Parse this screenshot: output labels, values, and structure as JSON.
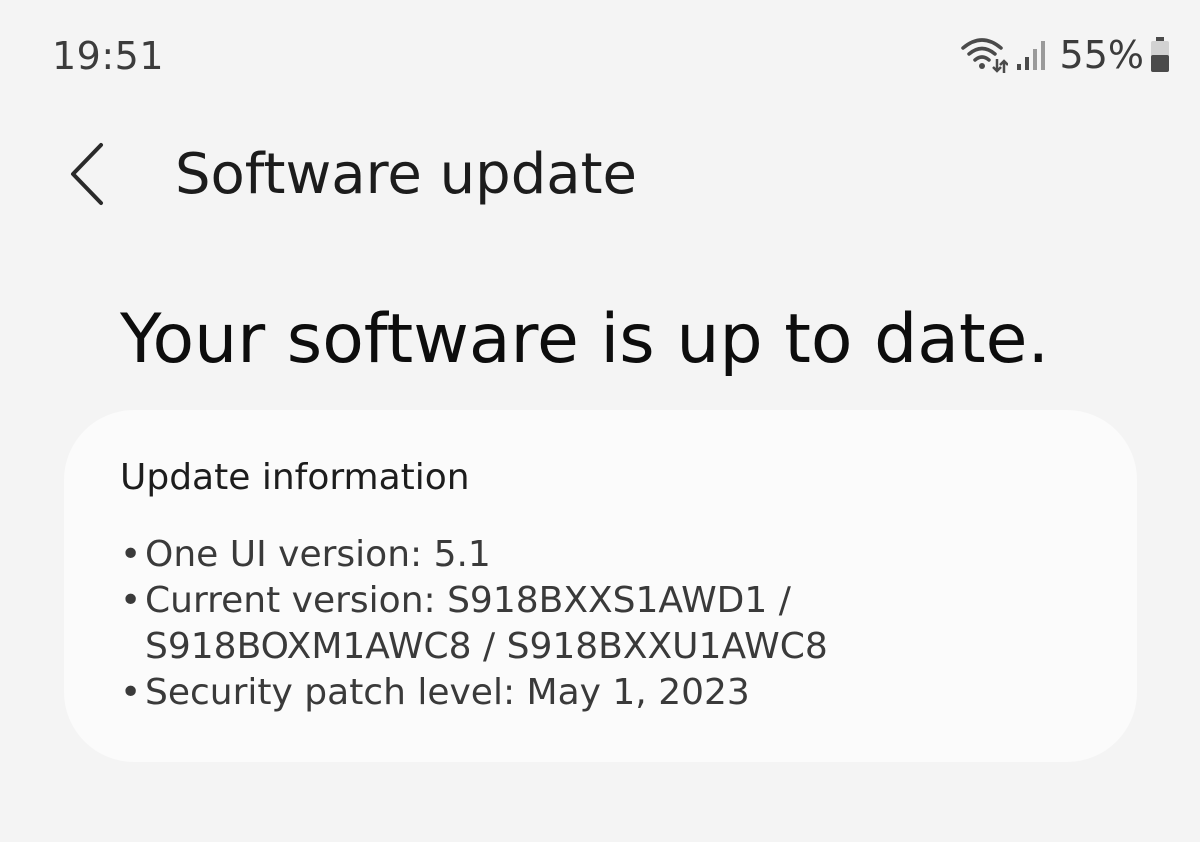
{
  "status_bar": {
    "time": "19:51",
    "battery_percent": "55%",
    "battery_level": 0.55,
    "icons": [
      "wifi-icon",
      "signal-icon",
      "battery-icon"
    ]
  },
  "header": {
    "back_icon": "chevron-left-icon",
    "title": "Software update"
  },
  "status_message": "Your software is up to date.",
  "update_info": {
    "title": "Update information",
    "bullet": "•",
    "items": [
      {
        "lines": [
          "One UI version: 5.1"
        ]
      },
      {
        "lines": [
          "Current version: S918BXXS1AWD1 /",
          "S918BOXM1AWC8 / S918BXXU1AWC8"
        ]
      },
      {
        "lines": [
          "Security patch level: May 1, 2023"
        ]
      }
    ]
  },
  "colors": {
    "background": "#f4f4f4",
    "card": "#fbfbfb",
    "text_primary": "#111111",
    "text_secondary": "#3a3a3a"
  }
}
